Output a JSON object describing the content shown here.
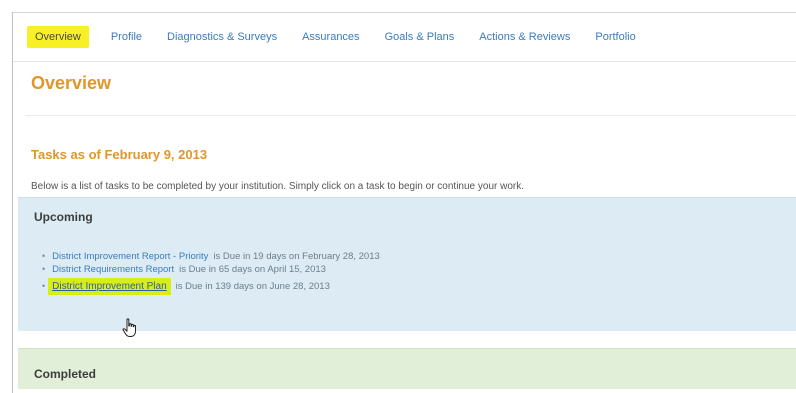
{
  "tabs": [
    {
      "label": "Overview",
      "active": true
    },
    {
      "label": "Profile"
    },
    {
      "label": "Diagnostics & Surveys"
    },
    {
      "label": "Assurances"
    },
    {
      "label": "Goals & Plans"
    },
    {
      "label": "Actions & Reviews"
    },
    {
      "label": "Portfolio"
    }
  ],
  "page_title": "Overview",
  "tasks": {
    "heading": "Tasks as of February 9, 2013",
    "intro": "Below is a list of tasks to be completed by your institution. Simply click on a task to begin or continue your work."
  },
  "upcoming": {
    "title": "Upcoming",
    "items": [
      {
        "link": "District Improvement Report - Priority",
        "due": "is Due in 19 days on February 28, 2013"
      },
      {
        "link": "District Requirements Report",
        "due": "is Due in 65 days on April 15, 2013"
      },
      {
        "link": "District Improvement Plan",
        "due": "is Due in 139 days on June 28, 2013",
        "highlighted": true
      }
    ]
  },
  "completed": {
    "title": "Completed"
  },
  "colors": {
    "accent_orange": "#e0962a",
    "link_blue": "#3a7cc0",
    "highlight_yellow": "#f7f025",
    "upcoming_bg": "#dcebf4",
    "completed_bg": "#e1efd8"
  },
  "icons": {
    "cursor": "hand-pointer-icon"
  }
}
